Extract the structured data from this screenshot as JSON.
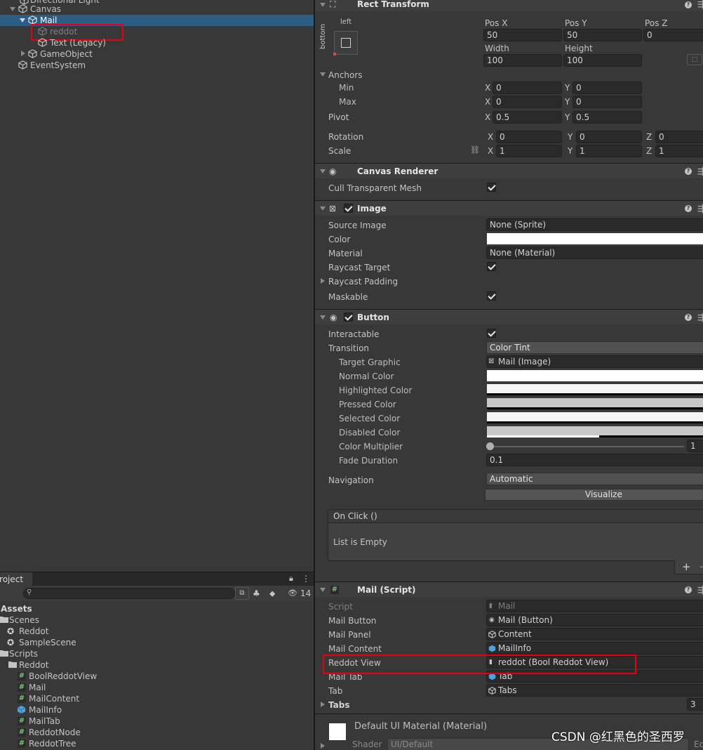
{
  "hierarchy": {
    "items": [
      {
        "label": "Directional Light"
      },
      {
        "label": "Canvas"
      },
      {
        "label": "Mail"
      },
      {
        "label": "reddot"
      },
      {
        "label": "Text (Legacy)"
      },
      {
        "label": "GameObject"
      },
      {
        "label": "EventSystem"
      }
    ]
  },
  "project": {
    "tab_label": "Project",
    "hidden_count": "14",
    "tree": [
      {
        "label": "Assets"
      },
      {
        "label": "Scenes"
      },
      {
        "label": "Reddot"
      },
      {
        "label": "SampleScene"
      },
      {
        "label": "Scripts"
      },
      {
        "label": "Reddot"
      },
      {
        "label": "BoolReddotView"
      },
      {
        "label": "Mail"
      },
      {
        "label": "MailContent"
      },
      {
        "label": "MailInfo"
      },
      {
        "label": "MailTab"
      },
      {
        "label": "ReddotNode"
      },
      {
        "label": "ReddotTree"
      }
    ]
  },
  "inspector": {
    "rect_transform": {
      "title": "Rect Transform",
      "anchor_h": "left",
      "anchor_v": "bottom",
      "pos_x_label": "Pos X",
      "pos_x": "50",
      "pos_y_label": "Pos Y",
      "pos_y": "50",
      "pos_z_label": "Pos Z",
      "pos_z": "0",
      "width_label": "Width",
      "width": "100",
      "height_label": "Height",
      "height": "100",
      "anchors_label": "Anchors",
      "min_label": "Min",
      "min_x": "0",
      "min_y": "0",
      "max_label": "Max",
      "max_x": "0",
      "max_y": "0",
      "pivot_label": "Pivot",
      "pivot_x": "0.5",
      "pivot_y": "0.5",
      "rotation_label": "Rotation",
      "rot_x": "0",
      "rot_y": "0",
      "rot_z": "0",
      "scale_label": "Scale",
      "scale_x": "1",
      "scale_y": "1",
      "scale_z": "1",
      "x": "X",
      "y": "Y",
      "z": "Z"
    },
    "canvas_renderer": {
      "title": "Canvas Renderer",
      "cull_label": "Cull Transparent Mesh"
    },
    "image": {
      "title": "Image",
      "source_label": "Source Image",
      "source_value": "None (Sprite)",
      "color_label": "Color",
      "material_label": "Material",
      "material_value": "None (Material)",
      "raycast_target_label": "Raycast Target",
      "raycast_padding_label": "Raycast Padding",
      "maskable_label": "Maskable"
    },
    "button": {
      "title": "Button",
      "interactable_label": "Interactable",
      "transition_label": "Transition",
      "transition_value": "Color Tint",
      "target_graphic_label": "Target Graphic",
      "target_graphic_value": "Mail (Image)",
      "normal_label": "Normal Color",
      "highlighted_label": "Highlighted Color",
      "pressed_label": "Pressed Color",
      "selected_label": "Selected Color",
      "disabled_label": "Disabled Color",
      "multiplier_label": "Color Multiplier",
      "multiplier_value": "1",
      "fade_label": "Fade Duration",
      "fade_value": "0.1",
      "navigation_label": "Navigation",
      "navigation_value": "Automatic",
      "visualize_label": "Visualize",
      "onclick_label": "On Click ()",
      "list_empty": "List is Empty",
      "add_label": "+",
      "remove_label": "−"
    },
    "mail_script": {
      "title": "Mail (Script)",
      "script_label": "Script",
      "script_value": "Mail",
      "mail_button_label": "Mail Button",
      "mail_button_value": "Mail (Button)",
      "mail_panel_label": "Mail Panel",
      "mail_panel_value": "Content",
      "mail_content_label": "Mail Content",
      "mail_content_value": "MailInfo",
      "reddot_view_label": "Reddot View",
      "reddot_view_value": "reddot (Bool Reddot View)",
      "mail_tab_label": "Mail Tab",
      "mail_tab_value": "Tab",
      "tab_label": "Tab",
      "tab_value": "Tabs",
      "tabs_label": "Tabs",
      "tabs_value": "3"
    },
    "material": {
      "title": "Default UI Material (Material)",
      "shader_label": "Shader",
      "shader_value": "UI/Default",
      "edit_label": "Ed"
    }
  },
  "watermark": "CSDN @红黑色的圣西罗",
  "colors": {
    "selection": "#2c5d87",
    "highlight_red": "#e60012",
    "panel_bg": "#383838",
    "field_bg": "#2a2a2a"
  }
}
